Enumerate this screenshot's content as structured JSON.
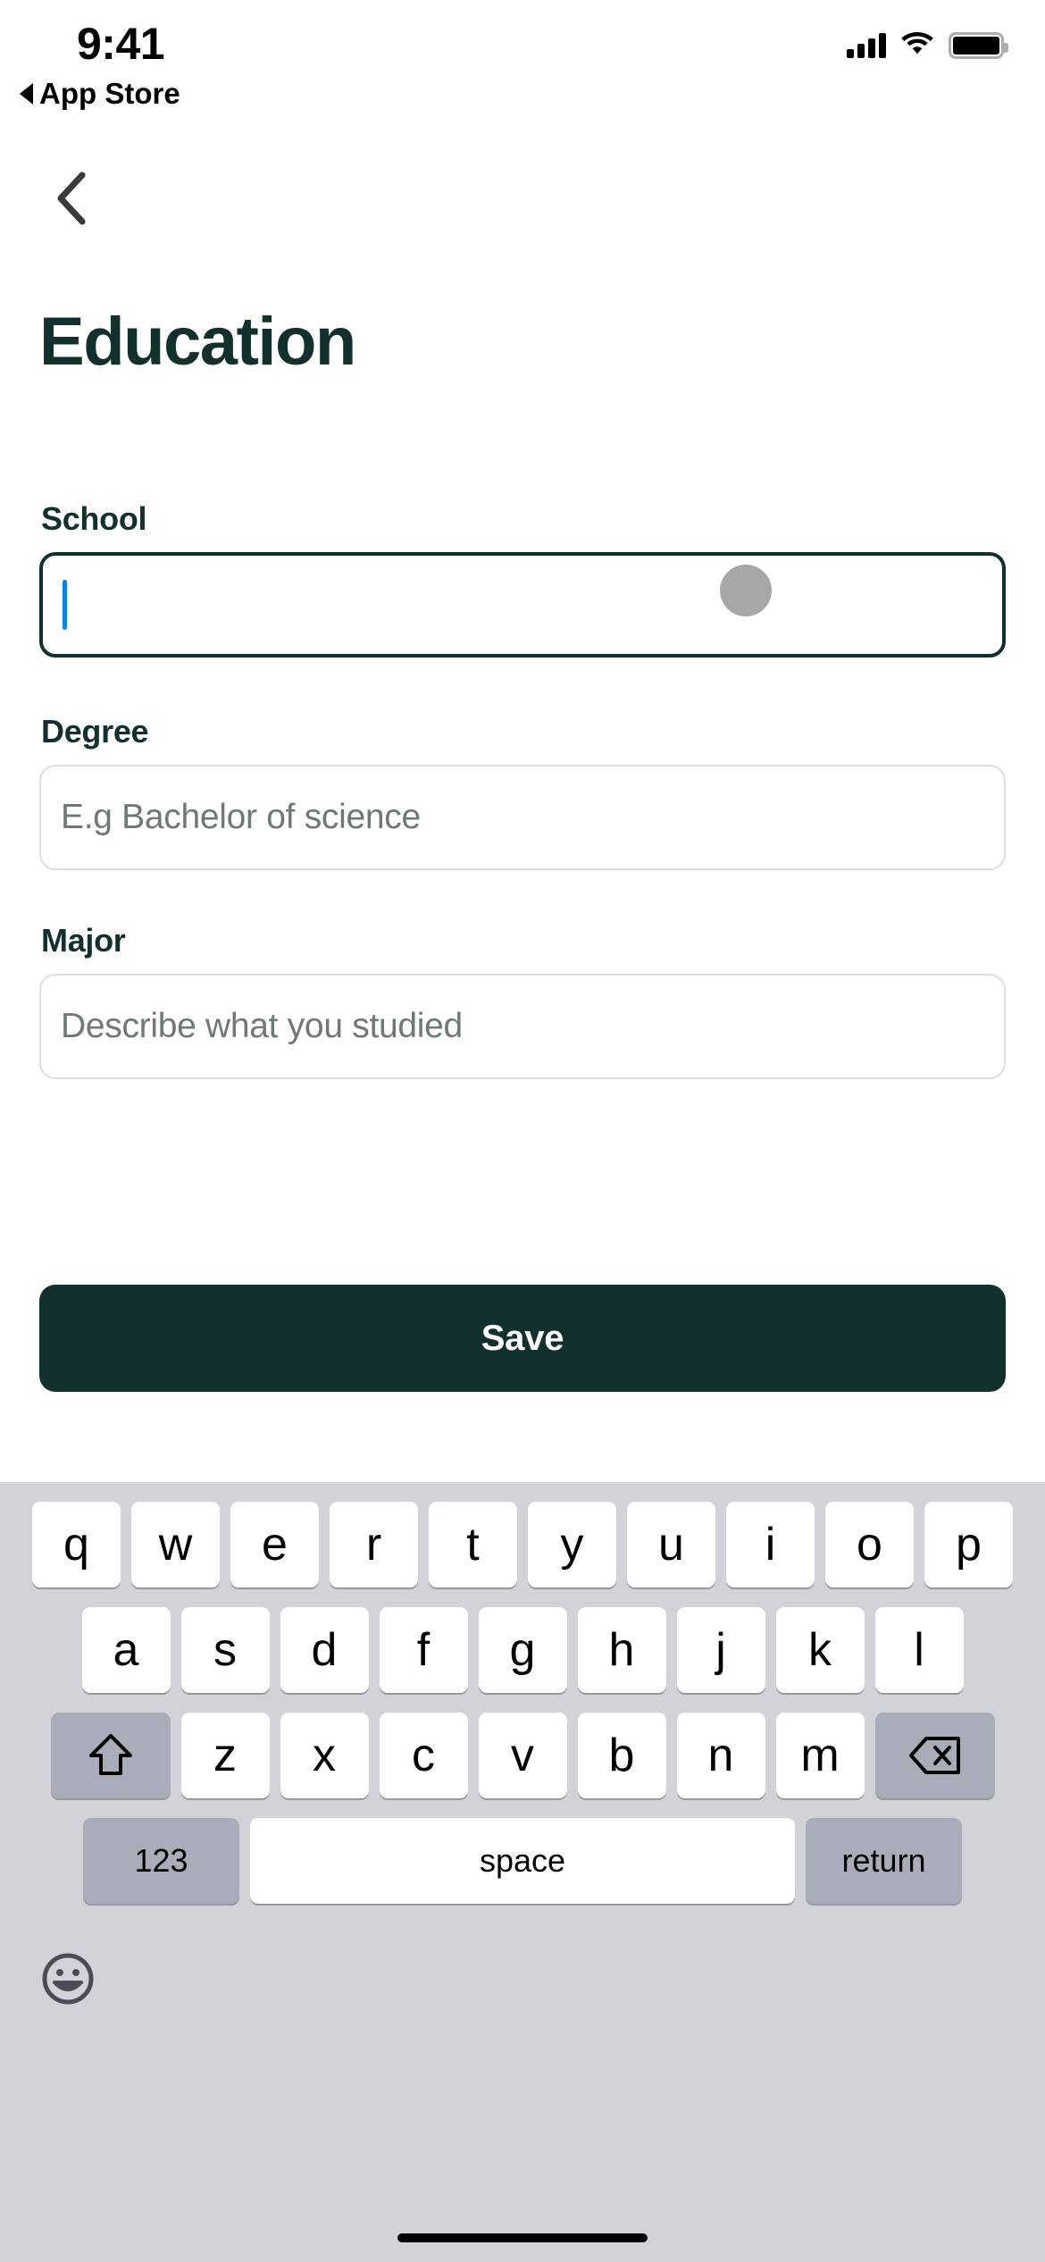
{
  "status_bar": {
    "time": "9:41",
    "back_to_app": "App Store",
    "signal_icon": "cellular-signal-icon",
    "wifi_icon": "wifi-icon",
    "battery_icon": "battery-icon"
  },
  "nav": {
    "back_icon": "chevron-left-icon"
  },
  "header": {
    "title": "Education",
    "title_color": "#12302e"
  },
  "form": {
    "fields": [
      {
        "label": "School",
        "value": "",
        "placeholder": "",
        "focused": true
      },
      {
        "label": "Degree",
        "value": "",
        "placeholder": "E.g Bachelor of science",
        "focused": false
      },
      {
        "label": "Major",
        "value": "",
        "placeholder": "Describe what you studied",
        "focused": false
      }
    ],
    "save_label": "Save",
    "save_bg": "#12302e",
    "caret_color": "#0a84e8",
    "placeholder_color": "#6f7878"
  },
  "touch_indicator": {
    "name": "touch-point-indicator",
    "color": "#a0a0a0"
  },
  "keyboard": {
    "background": "#d1d3d9",
    "row1": [
      "q",
      "w",
      "e",
      "r",
      "t",
      "y",
      "u",
      "i",
      "o",
      "p"
    ],
    "row2": [
      "a",
      "s",
      "d",
      "f",
      "g",
      "h",
      "j",
      "k",
      "l"
    ],
    "row3": [
      "z",
      "x",
      "c",
      "v",
      "b",
      "n",
      "m"
    ],
    "shift_icon": "shift-arrow-icon",
    "backspace_icon": "backspace-delete-icon",
    "numbers_label": "123",
    "space_label": "space",
    "return_label": "return",
    "emoji_icon": "emoji-smiley-icon"
  }
}
